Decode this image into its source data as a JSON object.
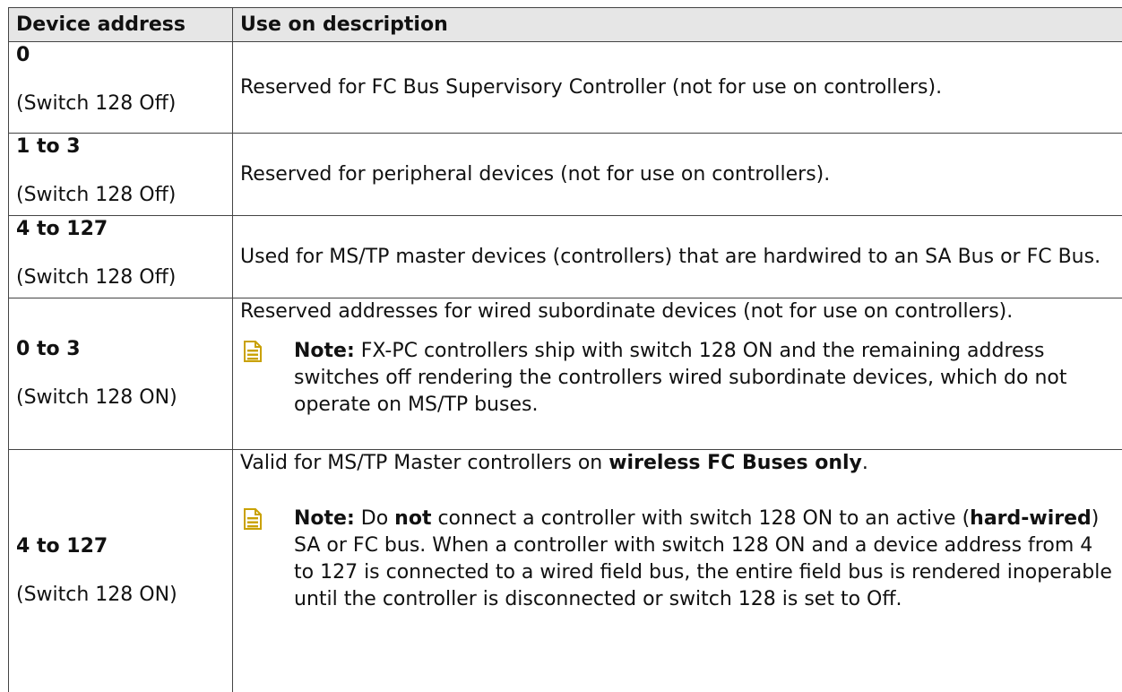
{
  "table": {
    "headers": {
      "address": "Device address",
      "description": "Use on description"
    },
    "rows": [
      {
        "address": "0",
        "switch": "(Switch 128 Off)",
        "description": "Reserved for FC Bus Supervisory Controller (not for use on controllers)."
      },
      {
        "address": "1 to 3",
        "switch": "(Switch 128 Off)",
        "description": "Reserved for peripheral devices (not for use on controllers)."
      },
      {
        "address": "4 to 127",
        "switch": "(Switch 128 Off)",
        "description": "Used for MS/TP master devices (controllers) that are hardwired to an SA Bus or FC Bus."
      },
      {
        "address": "0 to 3",
        "switch": "(Switch 128 ON)",
        "description": "Reserved addresses for wired subordinate devices (not for use on controllers).",
        "note_label": "Note:",
        "note_text": "FX-PC controllers ship with switch 128 ON and the remaining address switches off rendering the controllers wired subordinate devices, which do not operate on MS/TP buses."
      },
      {
        "address": "4 to 127",
        "switch": "(Switch 128 ON)",
        "description_pre": "Valid for MS/TP Master controllers on ",
        "description_bold": "wireless FC Buses only",
        "description_post": ".",
        "note_label": "Note:",
        "note_p1": "Do ",
        "note_b1": "not",
        "note_p2": " connect a controller with switch 128 ON to an active (",
        "note_b2": "hard-wired",
        "note_p3": ") SA or FC bus. When a controller with switch 128 ON and a device address from 4 to 127 is connected to a wired field bus, the entire field bus is rendered inoperable until the controller is disconnected or switch 128 is set to Off."
      }
    ]
  },
  "colors": {
    "header_bg": "#e6e6e6",
    "note_icon": "#c9a100",
    "border": "#444444"
  },
  "icons": {
    "note": "note-icon"
  }
}
